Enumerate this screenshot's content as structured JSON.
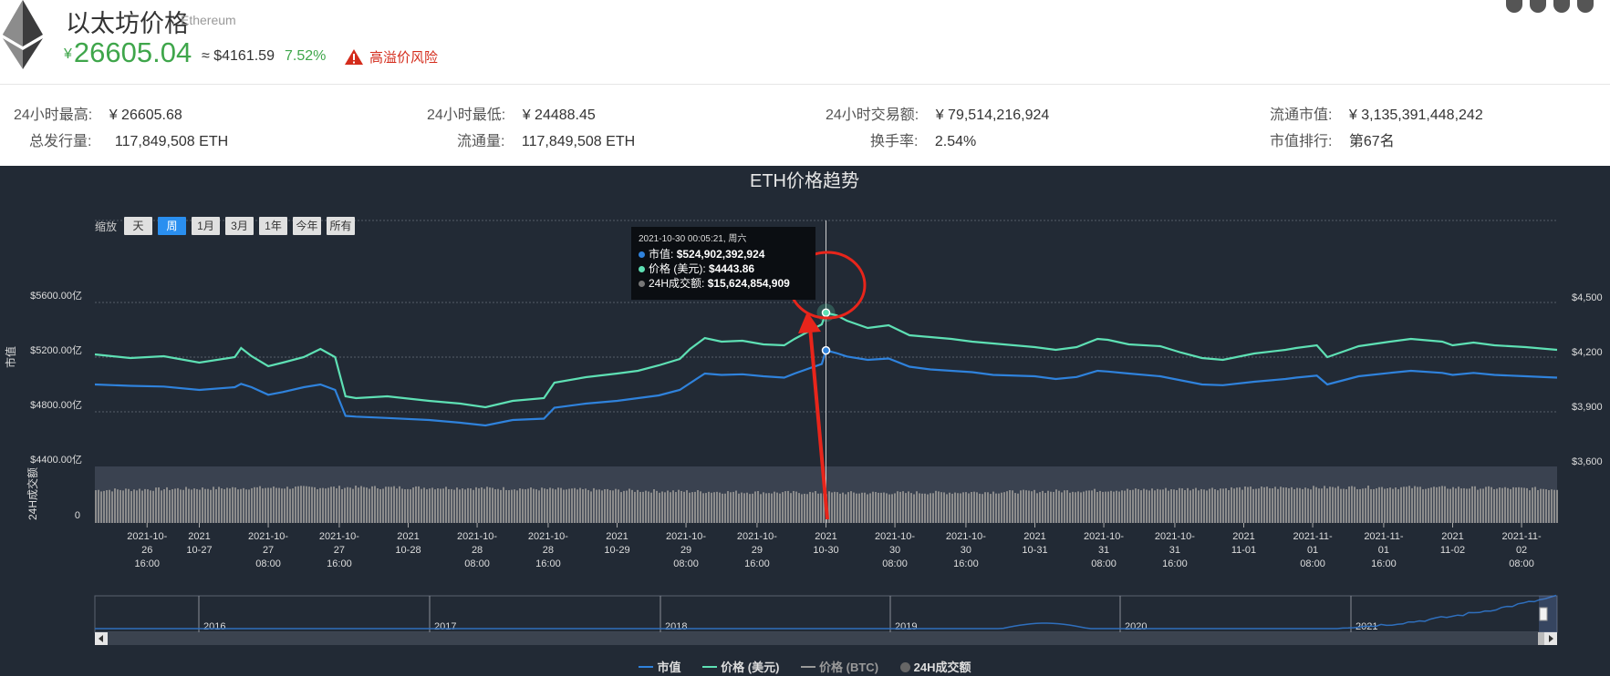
{
  "header": {
    "coin_name": "以太坊价格",
    "coin_english": "Ethereum",
    "price_currency": "¥",
    "price_cny": "26605.04",
    "price_usd": "≈ $4161.59",
    "change_pct": "7.52%",
    "risk_label": "高溢价风险",
    "colors": {
      "up": "#3fa64b",
      "risk": "#d42c1c"
    },
    "share_icons": [
      "globe-icon",
      "facebook-icon",
      "twitter-icon",
      "reddit-icon"
    ]
  },
  "stats": {
    "high_24h_label": "24小时最高:",
    "high_24h_value": "¥ 26605.68",
    "low_24h_label": "24小时最低:",
    "low_24h_value": "¥ 24488.45",
    "volume_24h_label": "24小时交易额:",
    "volume_24h_value": "¥ 79,514,216,924",
    "market_cap_label": "流通市值:",
    "market_cap_value": "¥ 3,135,391,448,242",
    "total_supply_label": "总发行量:",
    "total_supply_value": "117,849,508 ETH",
    "circulating_label": "流通量:",
    "circulating_value": "117,849,508 ETH",
    "turnover_label": "换手率:",
    "turnover_value": "2.54%",
    "rank_label": "市值排行:",
    "rank_value": "第67名"
  },
  "chart": {
    "range_label": "缩放",
    "range_buttons": [
      "天",
      "周",
      "1月",
      "3月",
      "1年",
      "今年",
      "所有"
    ],
    "active_range": "周",
    "tooltip": {
      "time": "2021-10-30 00:05:21, 周六",
      "market_cap_label": "市值:",
      "market_cap_value": "$524,902,392,924",
      "price_label": "价格 (美元):",
      "price_value": "$4443.86",
      "volume_label": "24H成交额:",
      "volume_value": "$15,624,854,909"
    },
    "navigator_years": [
      "2016",
      "2017",
      "2018",
      "2019",
      "2020",
      "2021"
    ],
    "legend": [
      "市值",
      "价格 (美元)",
      "价格 (BTC)",
      "24H成交额"
    ]
  },
  "chart_data": {
    "type": "line",
    "title": "ETH价格趋势",
    "y_left_label": "市值",
    "y_left_ticks": [
      "$4400.00亿",
      "$4800.00亿",
      "$5200.00亿",
      "$5600.00亿"
    ],
    "y_right_ticks": [
      "$3,600",
      "$3,900",
      "$4,200",
      "$4,500"
    ],
    "volume_axis_label": "24H成交额",
    "volume_axis_ticks": [
      "0"
    ],
    "x_ticks": [
      {
        "t": 0.25,
        "l": [
          "2021-10-",
          "26",
          "16:00"
        ]
      },
      {
        "t": 0.5,
        "l": [
          "2021",
          "10-27"
        ]
      },
      {
        "t": 0.83,
        "l": [
          "2021-10-",
          "27",
          "08:00"
        ]
      },
      {
        "t": 1.17,
        "l": [
          "2021-10-",
          "27",
          "16:00"
        ]
      },
      {
        "t": 1.5,
        "l": [
          "2021",
          "10-28"
        ]
      },
      {
        "t": 1.83,
        "l": [
          "2021-10-",
          "28",
          "08:00"
        ]
      },
      {
        "t": 2.17,
        "l": [
          "2021-10-",
          "28",
          "16:00"
        ]
      },
      {
        "t": 2.5,
        "l": [
          "2021",
          "10-29"
        ]
      },
      {
        "t": 2.83,
        "l": [
          "2021-10-",
          "29",
          "08:00"
        ]
      },
      {
        "t": 3.17,
        "l": [
          "2021-10-",
          "29",
          "16:00"
        ]
      },
      {
        "t": 3.5,
        "l": [
          "2021",
          "10-30"
        ]
      },
      {
        "t": 3.83,
        "l": [
          "2021-10-",
          "30",
          "08:00"
        ]
      },
      {
        "t": 4.17,
        "l": [
          "2021-10-",
          "30",
          "16:00"
        ]
      },
      {
        "t": 4.5,
        "l": [
          "2021",
          "10-31"
        ]
      },
      {
        "t": 4.83,
        "l": [
          "2021-10-",
          "31",
          "08:00"
        ]
      },
      {
        "t": 5.17,
        "l": [
          "2021-10-",
          "31",
          "16:00"
        ]
      },
      {
        "t": 5.5,
        "l": [
          "2021",
          "11-01"
        ]
      },
      {
        "t": 5.83,
        "l": [
          "2021-11-",
          "01",
          "08:00"
        ]
      },
      {
        "t": 6.17,
        "l": [
          "2021-11-",
          "01",
          "16:00"
        ]
      },
      {
        "t": 6.5,
        "l": [
          "2021",
          "11-02"
        ]
      },
      {
        "t": 6.83,
        "l": [
          "2021-11-",
          "02",
          "08:00"
        ]
      }
    ],
    "x_range": [
      0,
      7.0
    ],
    "price_ylim": [
      3600,
      4500
    ],
    "series": [
      {
        "name": "价格 (美元)",
        "color": "#5ee0b4",
        "points": [
          [
            0,
            4215
          ],
          [
            0.17,
            4195
          ],
          [
            0.33,
            4205
          ],
          [
            0.5,
            4170
          ],
          [
            0.67,
            4200
          ],
          [
            0.7,
            4250
          ],
          [
            0.75,
            4205
          ],
          [
            0.83,
            4150
          ],
          [
            0.9,
            4170
          ],
          [
            1.0,
            4200
          ],
          [
            1.08,
            4245
          ],
          [
            1.15,
            4200
          ],
          [
            1.2,
            3985
          ],
          [
            1.25,
            3975
          ],
          [
            1.4,
            3985
          ],
          [
            1.6,
            3960
          ],
          [
            1.75,
            3945
          ],
          [
            1.87,
            3925
          ],
          [
            2.0,
            3960
          ],
          [
            2.15,
            3975
          ],
          [
            2.2,
            4060
          ],
          [
            2.35,
            4090
          ],
          [
            2.5,
            4110
          ],
          [
            2.6,
            4125
          ],
          [
            2.7,
            4155
          ],
          [
            2.8,
            4190
          ],
          [
            2.85,
            4245
          ],
          [
            2.92,
            4305
          ],
          [
            3.0,
            4285
          ],
          [
            3.1,
            4290
          ],
          [
            3.2,
            4270
          ],
          [
            3.3,
            4265
          ],
          [
            3.35,
            4300
          ],
          [
            3.48,
            4380
          ],
          [
            3.5,
            4443
          ],
          [
            3.55,
            4430
          ],
          [
            3.6,
            4400
          ],
          [
            3.7,
            4360
          ],
          [
            3.8,
            4375
          ],
          [
            3.9,
            4320
          ],
          [
            4.0,
            4310
          ],
          [
            4.1,
            4300
          ],
          [
            4.2,
            4285
          ],
          [
            4.3,
            4275
          ],
          [
            4.5,
            4255
          ],
          [
            4.6,
            4240
          ],
          [
            4.7,
            4255
          ],
          [
            4.8,
            4300
          ],
          [
            4.85,
            4295
          ],
          [
            4.95,
            4270
          ],
          [
            5.1,
            4260
          ],
          [
            5.2,
            4225
          ],
          [
            5.3,
            4195
          ],
          [
            5.4,
            4185
          ],
          [
            5.55,
            4220
          ],
          [
            5.7,
            4240
          ],
          [
            5.75,
            4250
          ],
          [
            5.85,
            4265
          ],
          [
            5.9,
            4200
          ],
          [
            5.95,
            4220
          ],
          [
            6.05,
            4260
          ],
          [
            6.2,
            4285
          ],
          [
            6.3,
            4300
          ],
          [
            6.45,
            4285
          ],
          [
            6.5,
            4265
          ],
          [
            6.6,
            4280
          ],
          [
            6.7,
            4265
          ],
          [
            6.85,
            4255
          ],
          [
            7.0,
            4240
          ]
        ]
      },
      {
        "name": "市值",
        "color": "#2f82dc",
        "points": [
          [
            0,
            5000
          ],
          [
            0.17,
            4990
          ],
          [
            0.33,
            4985
          ],
          [
            0.5,
            4960
          ],
          [
            0.67,
            4980
          ],
          [
            0.7,
            5005
          ],
          [
            0.75,
            4980
          ],
          [
            0.83,
            4925
          ],
          [
            0.9,
            4945
          ],
          [
            1.0,
            4980
          ],
          [
            1.08,
            5000
          ],
          [
            1.15,
            4960
          ],
          [
            1.2,
            4770
          ],
          [
            1.25,
            4765
          ],
          [
            1.4,
            4755
          ],
          [
            1.6,
            4740
          ],
          [
            1.75,
            4720
          ],
          [
            1.87,
            4700
          ],
          [
            2.0,
            4740
          ],
          [
            2.15,
            4750
          ],
          [
            2.2,
            4830
          ],
          [
            2.35,
            4860
          ],
          [
            2.5,
            4880
          ],
          [
            2.6,
            4900
          ],
          [
            2.7,
            4920
          ],
          [
            2.8,
            4960
          ],
          [
            2.85,
            5010
          ],
          [
            2.92,
            5080
          ],
          [
            3.0,
            5070
          ],
          [
            3.1,
            5075
          ],
          [
            3.2,
            5060
          ],
          [
            3.3,
            5050
          ],
          [
            3.35,
            5080
          ],
          [
            3.48,
            5150
          ],
          [
            3.5,
            5249
          ],
          [
            3.55,
            5230
          ],
          [
            3.6,
            5205
          ],
          [
            3.7,
            5180
          ],
          [
            3.8,
            5190
          ],
          [
            3.9,
            5130
          ],
          [
            4.0,
            5110
          ],
          [
            4.1,
            5100
          ],
          [
            4.2,
            5090
          ],
          [
            4.3,
            5070
          ],
          [
            4.5,
            5060
          ],
          [
            4.6,
            5040
          ],
          [
            4.7,
            5055
          ],
          [
            4.8,
            5100
          ],
          [
            4.85,
            5095
          ],
          [
            4.95,
            5080
          ],
          [
            5.1,
            5060
          ],
          [
            5.2,
            5030
          ],
          [
            5.3,
            5000
          ],
          [
            5.4,
            4995
          ],
          [
            5.55,
            5020
          ],
          [
            5.7,
            5040
          ],
          [
            5.75,
            5050
          ],
          [
            5.85,
            5065
          ],
          [
            5.9,
            5000
          ],
          [
            5.95,
            5020
          ],
          [
            6.05,
            5060
          ],
          [
            6.2,
            5085
          ],
          [
            6.3,
            5100
          ],
          [
            6.45,
            5085
          ],
          [
            6.5,
            5070
          ],
          [
            6.6,
            5085
          ],
          [
            6.7,
            5070
          ],
          [
            6.85,
            5060
          ],
          [
            7.0,
            5050
          ]
        ]
      }
    ],
    "volume_series": {
      "name": "24H成交额",
      "color": "#8a8a8a"
    },
    "highlight_point": {
      "t": 3.5,
      "price_usd": 4443.86,
      "market_cap_usd": 524902392924
    }
  }
}
